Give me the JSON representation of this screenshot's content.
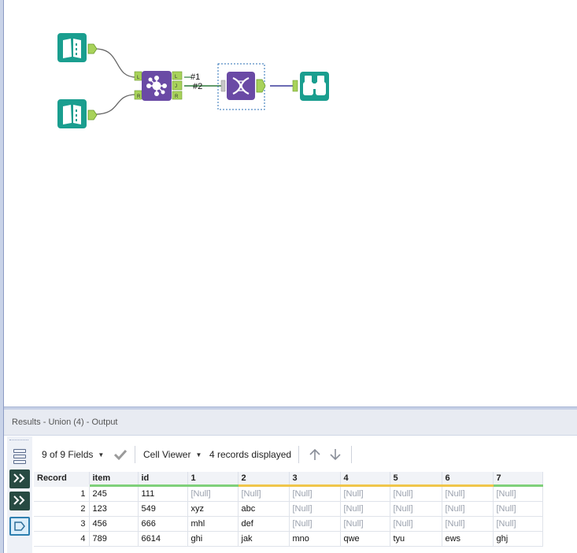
{
  "canvas": {
    "tools": [
      {
        "name": "input-data-1",
        "icon": "book-icon"
      },
      {
        "name": "input-data-2",
        "icon": "book-icon"
      },
      {
        "name": "join",
        "icon": "join-hub-icon",
        "anchors": [
          "L",
          "R",
          "L",
          "J",
          "R"
        ]
      },
      {
        "name": "union",
        "icon": "dna-icon"
      },
      {
        "name": "browse",
        "icon": "binoculars-icon"
      }
    ],
    "connection_labels": {
      "first": "#1",
      "second": "#2"
    }
  },
  "results": {
    "title": "Results - Union (4) - Output",
    "toolbar": {
      "fields_label": "9 of 9 Fields",
      "viewer_label": "Cell Viewer",
      "records_label": "4 records displayed"
    },
    "columns": [
      "Record",
      "item",
      "id",
      "1",
      "2",
      "3",
      "4",
      "5",
      "6",
      "7"
    ],
    "rows": [
      [
        "1",
        "245",
        "111",
        "[Null]",
        "[Null]",
        "[Null]",
        "[Null]",
        "[Null]",
        "[Null]",
        "[Null]"
      ],
      [
        "2",
        "123",
        "549",
        "xyz",
        "abc",
        "[Null]",
        "[Null]",
        "[Null]",
        "[Null]",
        "[Null]"
      ],
      [
        "3",
        "456",
        "666",
        "mhl",
        "def",
        "[Null]",
        "[Null]",
        "[Null]",
        "[Null]",
        "[Null]"
      ],
      [
        "4",
        "789",
        "6614",
        "ghi",
        "jak",
        "mno",
        "qwe",
        "tyu",
        "ews",
        "ghj"
      ]
    ]
  },
  "colors": {
    "input_tool": "#1a9e8f",
    "join_tool": "#6a4aa5",
    "union_tool": "#6a4aa5",
    "browse_tool": "#1a9e8f",
    "anchor": "#a8d25a",
    "selection": "#2a6fb5"
  }
}
